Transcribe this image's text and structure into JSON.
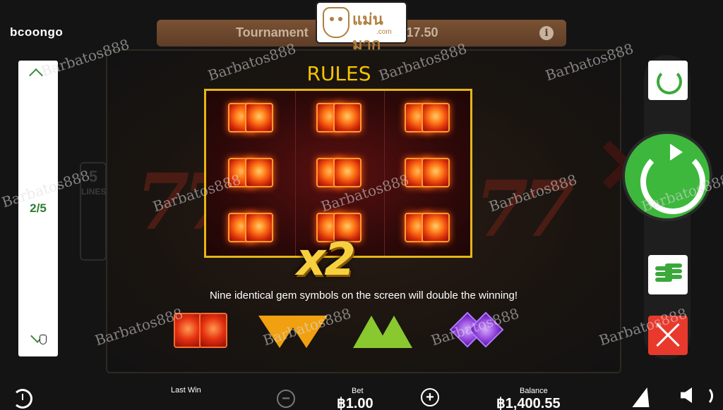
{
  "brand": "bcoongo",
  "tournament": {
    "label": "Tournament",
    "amount": "17.50",
    "info_icon": "info-icon"
  },
  "logo": {
    "name": "แม่นมาก",
    "domain": ".com"
  },
  "pager": {
    "count": "2/5",
    "up_icon": "chevron-up-icon",
    "down_icon": "chevron-down-icon"
  },
  "background": {
    "lines_number": "5",
    "lines_word": "LINES"
  },
  "rules": {
    "title": "RULES",
    "multiplier": "x2",
    "description": "Nine identical gem symbols on the screen will double the winning!",
    "gems": [
      "red-gem-icon",
      "orange-gem-icon",
      "green-gem-icon",
      "purple-gem-icon"
    ]
  },
  "controls": {
    "autoplay_icon": "autoplay-icon",
    "spin_icon": "spin-icon",
    "coins_icon": "coins-icon",
    "close_icon": "close-icon"
  },
  "bottom": {
    "last_win_label": "Last Win",
    "bet_label": "Bet",
    "bet_value": "฿1.00",
    "balance_label": "Balance",
    "balance_value": "฿1,400.55",
    "minus": "−",
    "plus": "+"
  },
  "watermark": "Barbatos888",
  "colors": {
    "accent": "#3db83d",
    "gold": "#f5c400",
    "close": "#e8392c"
  }
}
